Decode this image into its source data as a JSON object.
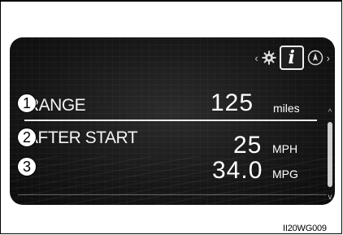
{
  "display": {
    "tabs": {
      "left_chevron": "‹",
      "right_chevron": "›",
      "settings_icon": "gear-icon",
      "info_icon": "info-icon",
      "info_glyph": "i",
      "navigation_icon": "compass-icon"
    },
    "rows": [
      {
        "callout": "1",
        "label": "RANGE",
        "value": "125",
        "unit": "miles"
      },
      {
        "callout": "2",
        "label": "AFTER START",
        "value": "25",
        "unit": "MPH"
      },
      {
        "callout": "3",
        "label": "",
        "value": "34.0",
        "unit": "MPG"
      }
    ],
    "scrollbar": {
      "up_glyph": "^",
      "down_glyph": "v"
    }
  },
  "caption": "II20WG009",
  "colors": {
    "screen_background": "#161616",
    "text": "#ffffff",
    "separator": "#e8e8e8"
  }
}
